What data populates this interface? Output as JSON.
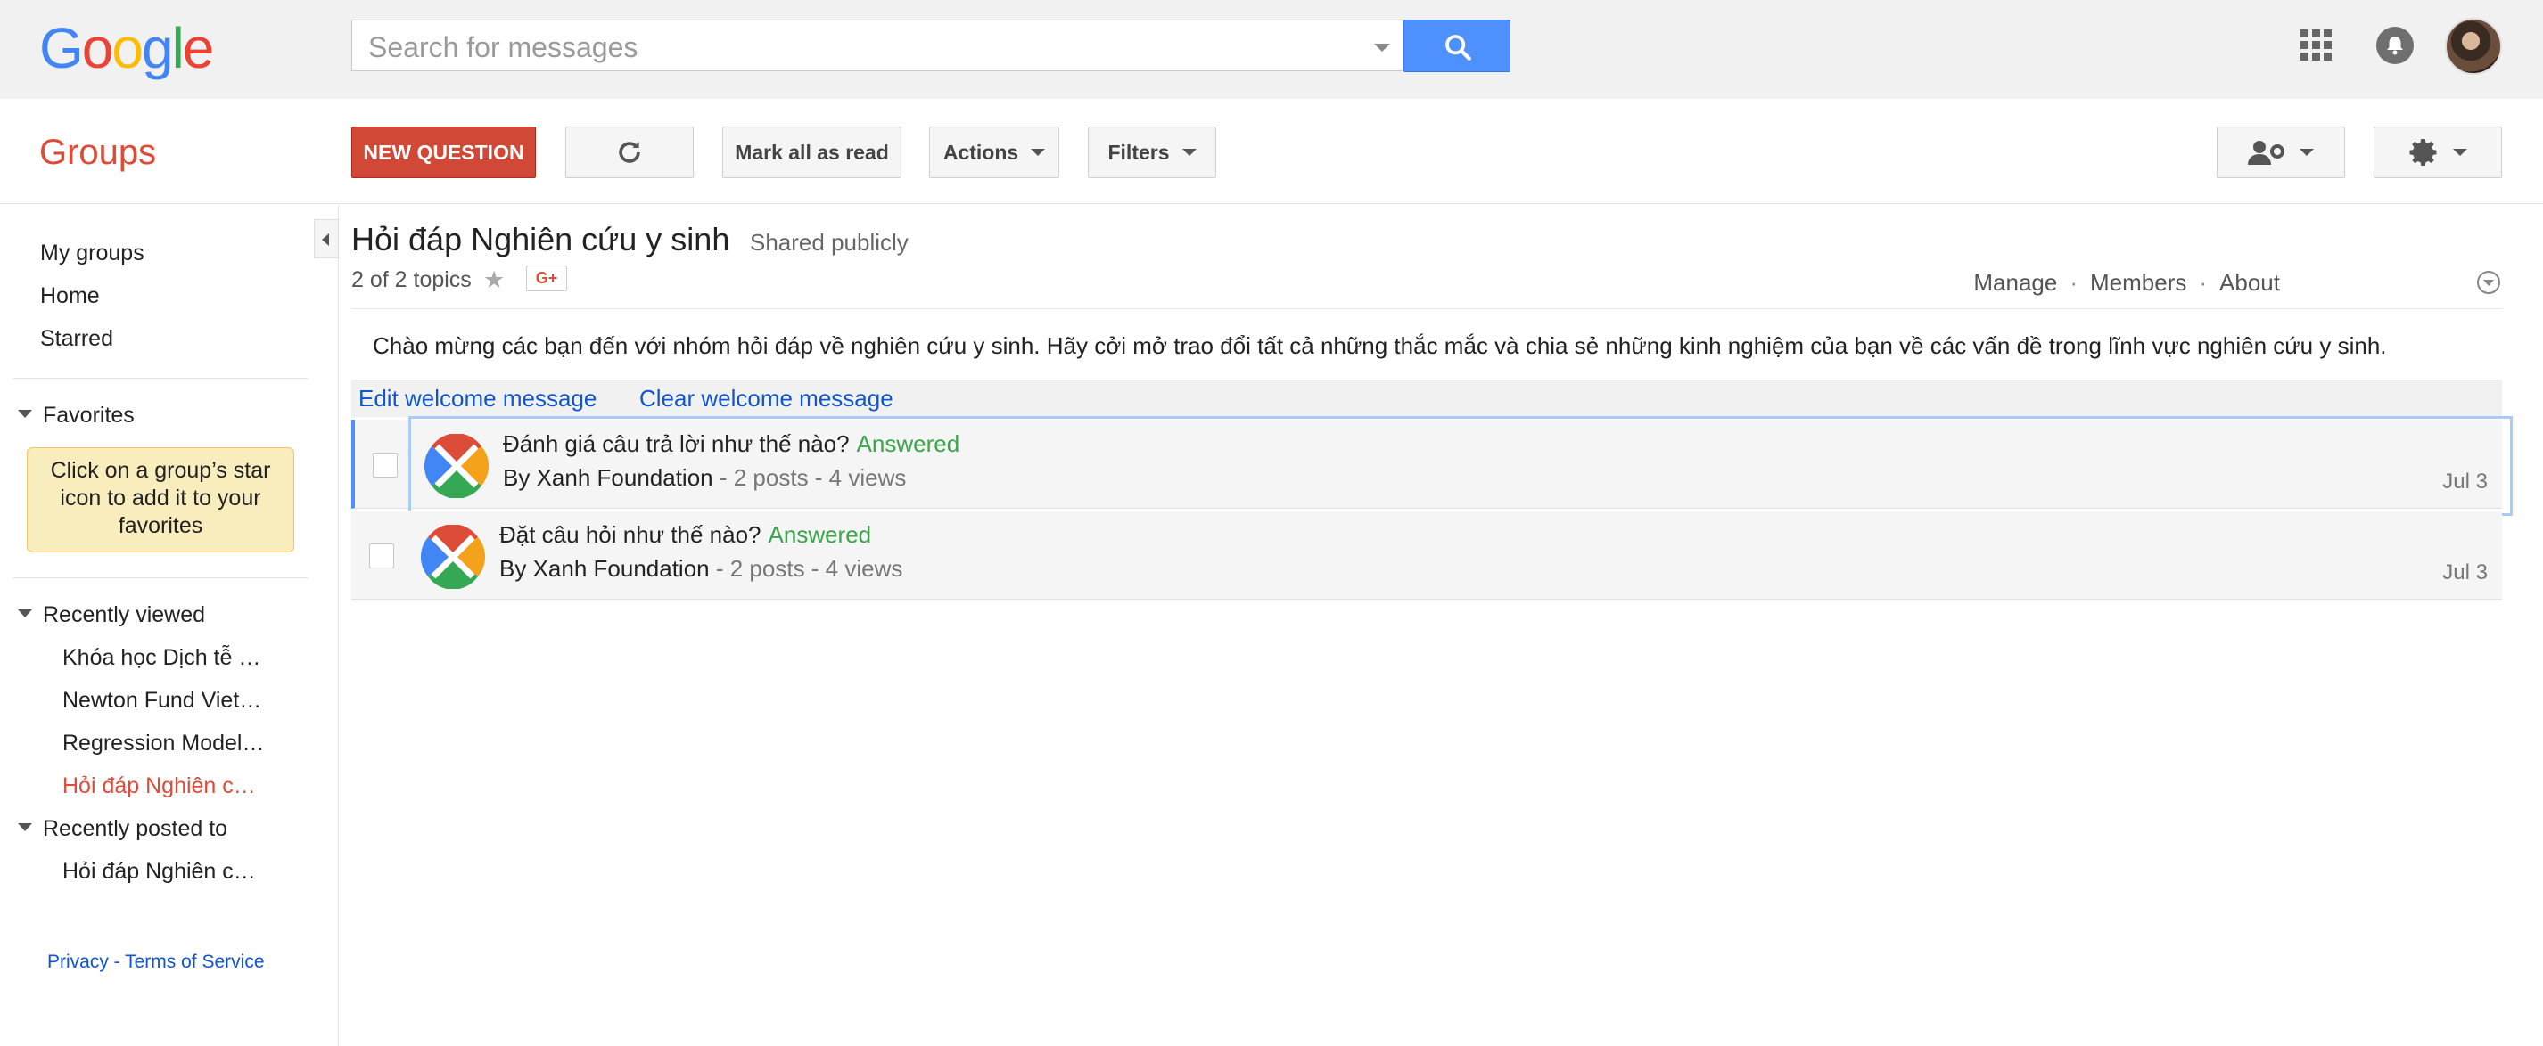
{
  "header": {
    "logo_letters": [
      {
        "ch": "G",
        "color": "#4285F4"
      },
      {
        "ch": "o",
        "color": "#EA4335"
      },
      {
        "ch": "o",
        "color": "#FBBC05"
      },
      {
        "ch": "g",
        "color": "#4285F4"
      },
      {
        "ch": "l",
        "color": "#34A853"
      },
      {
        "ch": "e",
        "color": "#EA4335"
      }
    ],
    "search_placeholder": "Search for messages",
    "icons": [
      "apps-icon",
      "bell-icon",
      "avatar"
    ]
  },
  "toolbar": {
    "app_title": "Groups",
    "new_question": "NEW QUESTION",
    "mark_all_read": "Mark all as read",
    "actions": "Actions",
    "filters": "Filters"
  },
  "sidebar": {
    "links": [
      "My groups",
      "Home",
      "Starred"
    ],
    "favorites_label": "Favorites",
    "favorites_note": "Click on a group’s star icon to add it to your favorites",
    "recently_viewed_label": "Recently viewed",
    "recently_viewed": [
      {
        "label": "Khóa học Dịch tễ …",
        "active": false
      },
      {
        "label": "Newton Fund Viet…",
        "active": false
      },
      {
        "label": "Regression Model…",
        "active": false
      },
      {
        "label": "Hỏi đáp Nghiên c…",
        "active": true
      }
    ],
    "recently_posted_label": "Recently posted to",
    "recently_posted": [
      "Hỏi đáp Nghiên c…"
    ],
    "footer": "Privacy - Terms of Service"
  },
  "group": {
    "title": "Hỏi đáp Nghiên cứu y sinh",
    "visibility": "Shared publicly",
    "topics_count": "2 of 2 topics",
    "gplus_label": "G+",
    "links": [
      "Manage",
      "Members",
      "About"
    ],
    "welcome_message": "Chào mừng các bạn đến với nhóm hỏi đáp về nghiên cứu y sinh. Hãy cởi mở trao đổi tất cả những thắc mắc và chia sẻ những kinh nghiệm của bạn về các vấn đề trong lĩnh vực nghiên cứu y sinh.",
    "edit_welcome": "Edit welcome message",
    "clear_welcome": "Clear welcome message"
  },
  "topics": [
    {
      "subject": "Đánh giá câu trả lời như thế nào?",
      "status": "Answered",
      "author": "By Xanh Foundation",
      "meta": "- 2 posts - 4 views",
      "date": "Jul 3"
    },
    {
      "subject": "Đặt câu hỏi như thế nào?",
      "status": "Answered",
      "author": "By Xanh Foundation",
      "meta": "- 2 posts - 4 views",
      "date": "Jul 3"
    }
  ]
}
